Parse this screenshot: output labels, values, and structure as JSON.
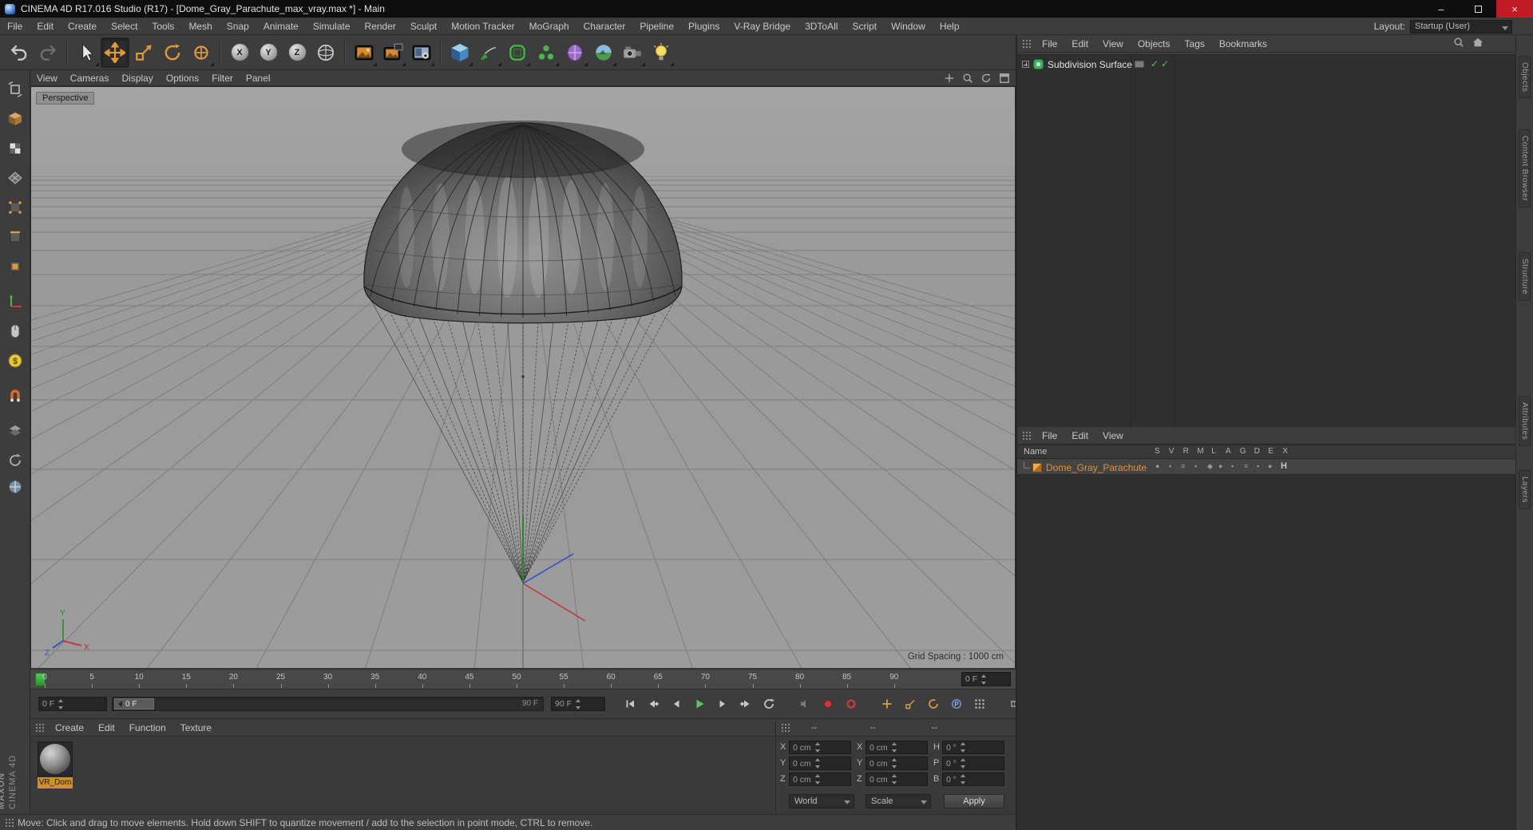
{
  "window": {
    "title": "CINEMA 4D R17.016 Studio (R17) - [Dome_Gray_Parachute_max_vray.max *] - Main",
    "controls": {
      "minimize": "–",
      "close": "×"
    }
  },
  "menubar": {
    "items": [
      "File",
      "Edit",
      "Create",
      "Select",
      "Tools",
      "Mesh",
      "Snap",
      "Animate",
      "Simulate",
      "Render",
      "Sculpt",
      "Motion Tracker",
      "MoGraph",
      "Character",
      "Pipeline",
      "Plugins",
      "V-Ray Bridge",
      "3DToAll",
      "Script",
      "Window",
      "Help"
    ],
    "layout_label": "Layout:",
    "layout_value": "Startup (User)"
  },
  "toolb": {
    "axis_locks": [
      "X",
      "Y",
      "Z"
    ]
  },
  "viewport": {
    "menu": [
      "View",
      "Cameras",
      "Display",
      "Options",
      "Filter",
      "Panel"
    ],
    "view_label": "Perspective",
    "grid_spacing": "Grid Spacing : 1000 cm",
    "axis_labels": {
      "x": "X",
      "y": "Y",
      "z": "Z"
    }
  },
  "object_manager": {
    "menu": [
      "File",
      "Edit",
      "View",
      "Objects",
      "Tags",
      "Bookmarks"
    ],
    "items": [
      {
        "name": "Subdivision Surface",
        "enabled_check": "✓"
      }
    ]
  },
  "attribute_manager": {
    "menu": [
      "File",
      "Edit",
      "View"
    ],
    "name_header": "Name",
    "columns": [
      "S",
      "V",
      "R",
      "M",
      "L",
      "A",
      "G",
      "D",
      "E",
      "X"
    ],
    "rows": [
      {
        "name": "Dome_Gray_Parachute",
        "badge": "H"
      }
    ]
  },
  "timeline": {
    "ticks": [
      0,
      5,
      10,
      15,
      20,
      25,
      30,
      35,
      40,
      45,
      50,
      55,
      60,
      65,
      70,
      75,
      80,
      85,
      90
    ],
    "frame_field": "0 F",
    "current_frame": "0 F",
    "range_end": "90 F",
    "end_field": "90 F"
  },
  "materials": {
    "menu": [
      "Create",
      "Edit",
      "Function",
      "Texture"
    ],
    "items": [
      {
        "label": "VR_Dom"
      }
    ]
  },
  "coordinates": {
    "headers": [
      "--",
      "--",
      "--"
    ],
    "rows": [
      {
        "a": "X",
        "av": "0 cm",
        "b": "X",
        "bv": "0 cm",
        "c": "H",
        "cv": "0 °"
      },
      {
        "a": "Y",
        "av": "0 cm",
        "b": "Y",
        "bv": "0 cm",
        "c": "P",
        "cv": "0 °"
      },
      {
        "a": "Z",
        "av": "0 cm",
        "b": "Z",
        "bv": "0 cm",
        "c": "B",
        "cv": "0 °"
      }
    ],
    "world": "World",
    "scale": "Scale",
    "apply": "Apply"
  },
  "statusbar": {
    "text": "Move: Click and drag to move elements. Hold down SHIFT to quantize movement / add to the selection in point mode, CTRL to remove."
  },
  "branding": {
    "line1": "MAXON",
    "line2": "CINEMA 4D"
  },
  "side_tabs": {
    "top": [
      "Objects",
      "Content Browser",
      "Structure"
    ],
    "bottom": [
      "Attributes",
      "Layers"
    ]
  }
}
